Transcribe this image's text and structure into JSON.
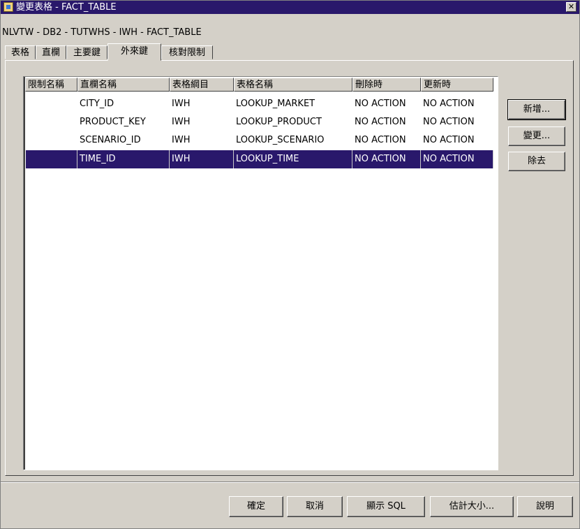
{
  "window": {
    "title": "變更表格 - FACT_TABLE",
    "close_glyph": "✕"
  },
  "path": "NLVTW - DB2 - TUTWHS - IWH - FACT_TABLE",
  "tabs": [
    {
      "label": "表格",
      "active": false
    },
    {
      "label": "直欄",
      "active": false
    },
    {
      "label": "主要鍵",
      "active": false
    },
    {
      "label": "外來鍵",
      "active": true
    },
    {
      "label": "核對限制",
      "active": false
    }
  ],
  "table": {
    "columns": [
      "限制名稱",
      "直欄名稱",
      "表格綱目",
      "表格名稱",
      "刪除時",
      "更新時"
    ],
    "rows": [
      [
        "",
        "CITY_ID",
        "IWH",
        "LOOKUP_MARKET",
        "NO ACTION",
        "NO ACTION"
      ],
      [
        "",
        "PRODUCT_KEY",
        "IWH",
        "LOOKUP_PRODUCT",
        "NO ACTION",
        "NO ACTION"
      ],
      [
        "",
        "SCENARIO_ID",
        "IWH",
        "LOOKUP_SCENARIO",
        "NO ACTION",
        "NO ACTION"
      ],
      [
        "",
        "TIME_ID",
        "IWH",
        "LOOKUP_TIME",
        "NO ACTION",
        "NO ACTION"
      ]
    ],
    "selected_row": 3
  },
  "side_buttons": {
    "add": "新增...",
    "change": "變更...",
    "remove": "除去"
  },
  "bottom_buttons": {
    "ok": "確定",
    "cancel": "取消",
    "show_sql": "顯示 SQL",
    "estimate_size": "估計大小...",
    "help": "說明"
  },
  "colors": {
    "title_bar": "#29186b",
    "selection": "#29186b",
    "dialog_bg": "#d4d0c8"
  }
}
